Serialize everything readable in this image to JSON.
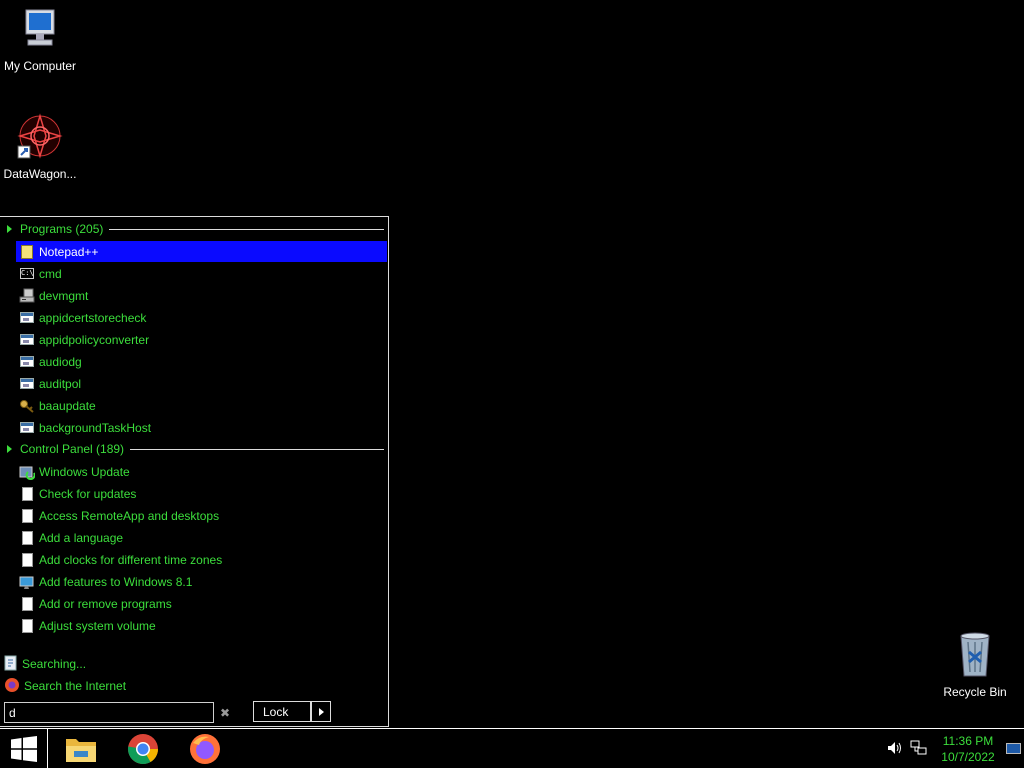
{
  "desktop": {
    "icons": [
      {
        "label": "My Computer"
      },
      {
        "label": "DataWagon..."
      },
      {
        "label": "Recycle Bin"
      }
    ]
  },
  "start_menu": {
    "programs_header": "Programs (205)",
    "programs": [
      {
        "label": "Notepad++",
        "icon": "notepad-icon",
        "selected": true
      },
      {
        "label": "cmd",
        "icon": "console-icon"
      },
      {
        "label": "devmgmt",
        "icon": "device-manager-icon"
      },
      {
        "label": "appidcertstorecheck",
        "icon": "app-window-icon"
      },
      {
        "label": "appidpolicyconverter",
        "icon": "app-window-icon"
      },
      {
        "label": "audiodg",
        "icon": "app-window-icon"
      },
      {
        "label": "auditpol",
        "icon": "app-window-icon"
      },
      {
        "label": "baaupdate",
        "icon": "keys-icon"
      },
      {
        "label": "backgroundTaskHost",
        "icon": "app-window-icon"
      }
    ],
    "control_panel_header": "Control Panel (189)",
    "control_panel": [
      {
        "label": "Windows Update",
        "icon": "windows-update-icon"
      },
      {
        "label": "Check for updates",
        "icon": "document-icon"
      },
      {
        "label": "Access RemoteApp and desktops",
        "icon": "document-icon"
      },
      {
        "label": "Add a language",
        "icon": "document-icon"
      },
      {
        "label": "Add clocks for different time zones",
        "icon": "document-icon"
      },
      {
        "label": "Add features to Windows 8.1",
        "icon": "add-features-icon"
      },
      {
        "label": "Add or remove programs",
        "icon": "document-icon"
      },
      {
        "label": "Adjust system volume",
        "icon": "document-icon"
      }
    ],
    "searching_label": "Searching...",
    "search_internet_label": "Search the Internet",
    "search_value": "d",
    "lock_label": "Lock"
  },
  "taskbar": {
    "apps": [
      "File Explorer",
      "Google Chrome",
      "Firefox"
    ],
    "clock_time": "11:36 PM",
    "clock_date": "10/7/2022"
  },
  "colors": {
    "accent_green": "#3cde3c",
    "selection_blue": "#0a0aff"
  }
}
